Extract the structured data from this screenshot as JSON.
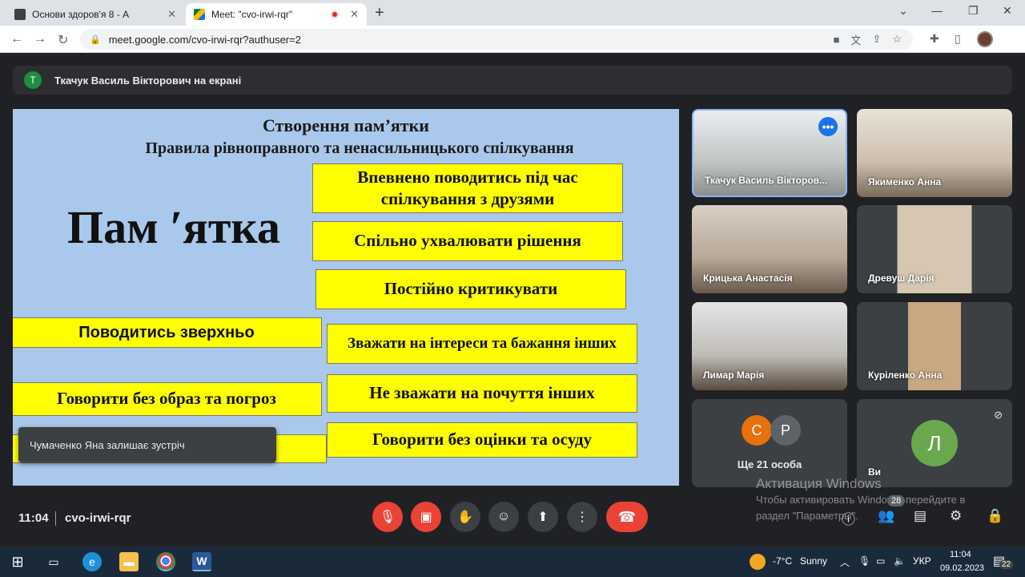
{
  "browser": {
    "tabs": [
      {
        "title": "Основи здоров'я 8 - А",
        "active": false
      },
      {
        "title": "Meet: \"cvo-irwi-rqr\"",
        "active": true
      }
    ],
    "url": "meet.google.com/cvo-irwi-rqr?authuser=2"
  },
  "meet": {
    "presenter_initial": "Т",
    "presenter_text": "Ткачук Василь Вікторович на екрані",
    "slide": {
      "title": "Створення пам’ятки",
      "subtitle": "Правила рівноправного та ненасильницького спілкування",
      "big_word": "Пам ʹятка",
      "boxes": [
        "Впевнено поводитись під час спілкування з друзями",
        "Спільно ухвалювати рішення",
        "Постійно критикувати",
        "Поводитись зверхньо",
        "Зважати на інтереси та бажання інших",
        "Говорити без образ та погроз",
        "Не зважати на почуття інших",
        "Говорити без оцінки та осуду"
      ]
    },
    "toast": "Чумаченко Яна залишає зустріч",
    "participants": [
      {
        "name": "Ткачук Василь Вікторов..."
      },
      {
        "name": "Якименко Анна"
      },
      {
        "name": "Крицька Анастасія"
      },
      {
        "name": "Древуш Дарія"
      },
      {
        "name": "Лимар Марія"
      },
      {
        "name": "Куріленко Анна"
      }
    ],
    "others": {
      "initials": [
        "С",
        "Р"
      ],
      "label": "Ще 21 особа"
    },
    "self": {
      "initial": "Л",
      "label": "Ви"
    },
    "time": "11:04",
    "code": "cvo-irwi-rqr",
    "people_count": "28",
    "watermark_title": "Активация Windows",
    "watermark_line1": "Чтобы активировать Windows, перейдите в",
    "watermark_line2": "раздел \"Параметры\".",
    "colors": {
      "accent": "#1a73e8",
      "danger": "#ea4335",
      "slide_bg": "#a9c8ec",
      "box": "#ffff00"
    }
  },
  "taskbar": {
    "temperature": "-7°C",
    "weather": "Sunny",
    "lang": "УКР",
    "time": "11:04",
    "date": "09.02.2023",
    "notifications": "22"
  }
}
